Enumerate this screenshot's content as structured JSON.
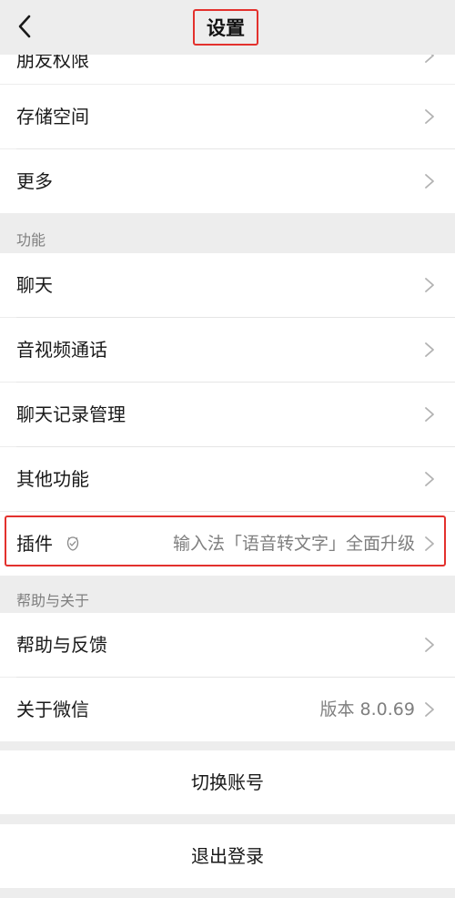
{
  "header": {
    "title": "设置",
    "back_icon": "chevron-left-icon"
  },
  "top_partial": {
    "label": "朋友权限"
  },
  "group1": [
    {
      "label": "存储空间"
    },
    {
      "label": "更多"
    }
  ],
  "section_features": {
    "title": "功能",
    "items": [
      {
        "label": "聊天"
      },
      {
        "label": "音视频通话"
      },
      {
        "label": "聊天记录管理"
      },
      {
        "label": "其他功能"
      },
      {
        "label": "插件",
        "value": "输入法「语音转文字」全面升级",
        "icon": "plugin-badge-icon"
      }
    ]
  },
  "section_about": {
    "title": "帮助与关于",
    "items": [
      {
        "label": "帮助与反馈"
      },
      {
        "label": "关于微信",
        "value": "版本 8.0.69"
      }
    ]
  },
  "actions": {
    "switch_account": "切换账号",
    "logout": "退出登录"
  },
  "colors": {
    "highlight": "#e3312d",
    "background": "#ededed",
    "row_bg": "#ffffff",
    "secondary_text": "#7f7f7f"
  }
}
